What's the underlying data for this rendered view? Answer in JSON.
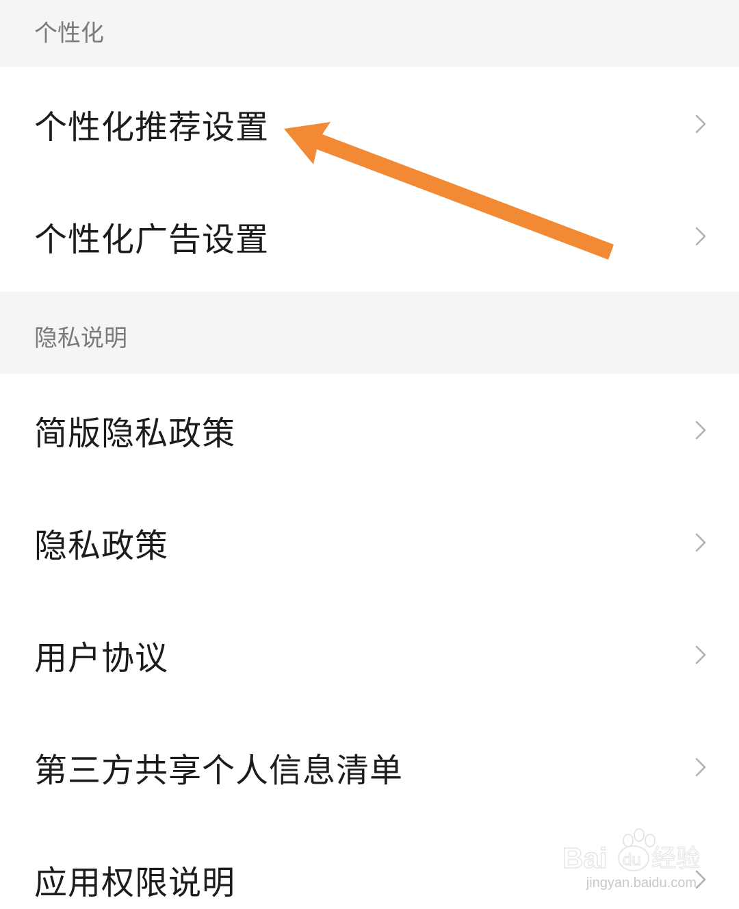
{
  "sections": [
    {
      "header": "个性化",
      "items": [
        {
          "label": "个性化推荐设置"
        },
        {
          "label": "个性化广告设置"
        }
      ]
    },
    {
      "header": "隐私说明",
      "items": [
        {
          "label": "简版隐私政策"
        },
        {
          "label": "隐私政策"
        },
        {
          "label": "用户协议"
        },
        {
          "label": "第三方共享个人信息清单"
        },
        {
          "label": "应用权限说明"
        }
      ]
    }
  ],
  "annotation": {
    "color": "#f28a35",
    "points_to": "个性化推荐设置"
  },
  "watermark": {
    "brand": "Baidu经验",
    "url": "jingyan.baidu.com"
  },
  "icons": {
    "chevron": "chevron-right-icon",
    "arrow": "annotation-arrow"
  }
}
